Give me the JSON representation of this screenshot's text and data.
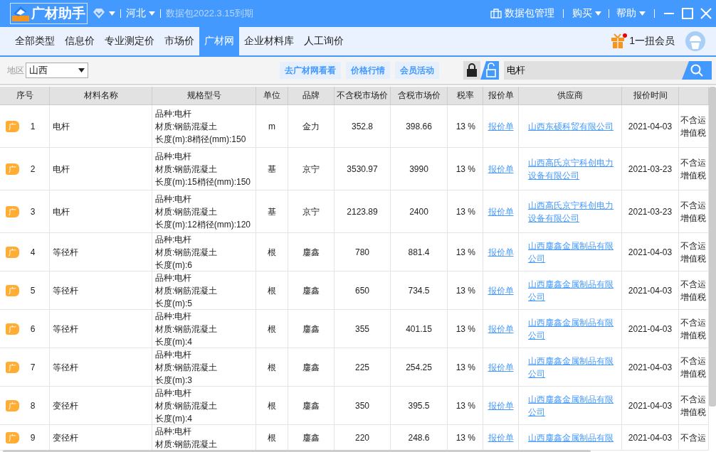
{
  "titlebar": {
    "app_name": "广材助手",
    "region": "河北",
    "expiry": "数据包2022.3.15到期",
    "data_pack": "数据包管理",
    "menus": [
      "购买",
      "帮助"
    ]
  },
  "nav": {
    "tabs": [
      {
        "label": "全部类型",
        "selected": false
      },
      {
        "label": "信息价",
        "selected": false
      },
      {
        "label": "专业测定价",
        "selected": false
      },
      {
        "label": "市场价",
        "selected": false
      },
      {
        "label": "广材网",
        "selected": true
      },
      {
        "label": "企业材料库",
        "selected": false
      },
      {
        "label": "人工询价",
        "selected": false
      }
    ],
    "member": "1一扭会员"
  },
  "toolbar": {
    "region_label": "地区",
    "region_value": "山西",
    "links": [
      "去广材网看看",
      "价格行情",
      "会员活动"
    ],
    "search_value": "电杆"
  },
  "table": {
    "columns": [
      "序号",
      "材料名称",
      "规格型号",
      "单位",
      "品牌",
      "不含税市场价",
      "含税市场价",
      "税率",
      "报价单",
      "供应商",
      "报价时间"
    ],
    "rows": [
      {
        "tag": "广",
        "no": "1",
        "name": "电杆",
        "spec_lines": [
          "品种:电杆",
          "材质:钢筋混凝土",
          "长度(m):8梢径(mm):150"
        ],
        "unit": "m",
        "brand": "金力",
        "price": "352.8",
        "tax_price": "398.66",
        "rate": "13 %",
        "quote": "报价单",
        "supplier": "山西东硕科贸有限公司",
        "date": "2021-04-03",
        "note_lines": [
          "不含运",
          "增值税"
        ]
      },
      {
        "tag": "广",
        "no": "2",
        "name": "电杆",
        "spec_lines": [
          "品种:电杆",
          "材质:钢筋混凝土",
          "长度(m):15梢径(mm):150"
        ],
        "unit": "基",
        "brand": "京宁",
        "price": "3530.97",
        "tax_price": "3990",
        "rate": "13 %",
        "quote": "报价单",
        "supplier": "山西高氏京宁科创电力设备有限公司",
        "date": "2021-03-23",
        "note_lines": [
          "不含运",
          "增值税"
        ]
      },
      {
        "tag": "广",
        "no": "3",
        "name": "电杆",
        "spec_lines": [
          "品种:电杆",
          "材质:钢筋混凝土",
          "长度(m):12梢径(mm):120"
        ],
        "unit": "基",
        "brand": "京宁",
        "price": "2123.89",
        "tax_price": "2400",
        "rate": "13 %",
        "quote": "报价单",
        "supplier": "山西高氏京宁科创电力设备有限公司",
        "date": "2021-03-23",
        "note_lines": [
          "不含运",
          "增值税"
        ]
      },
      {
        "tag": "广",
        "no": "4",
        "name": "等径杆",
        "spec_lines": [
          "品种:电杆",
          "材质:钢筋混凝土",
          "长度(m):6"
        ],
        "unit": "根",
        "brand": "鏖鑫",
        "price": "780",
        "tax_price": "881.4",
        "rate": "13 %",
        "quote": "报价单",
        "supplier": "山西鏖鑫金属制品有限公司",
        "date": "2021-04-03",
        "note_lines": [
          "不含运",
          "增值税"
        ]
      },
      {
        "tag": "广",
        "no": "5",
        "name": "等径杆",
        "spec_lines": [
          "品种:电杆",
          "材质:钢筋混凝土",
          "长度(m):5"
        ],
        "unit": "根",
        "brand": "鏖鑫",
        "price": "650",
        "tax_price": "734.5",
        "rate": "13 %",
        "quote": "报价单",
        "supplier": "山西鏖鑫金属制品有限公司",
        "date": "2021-04-03",
        "note_lines": [
          "不含运",
          "增值税"
        ]
      },
      {
        "tag": "广",
        "no": "6",
        "name": "等径杆",
        "spec_lines": [
          "品种:电杆",
          "材质:钢筋混凝土",
          "长度(m):4"
        ],
        "unit": "根",
        "brand": "鏖鑫",
        "price": "355",
        "tax_price": "401.15",
        "rate": "13 %",
        "quote": "报价单",
        "supplier": "山西鏖鑫金属制品有限公司",
        "date": "2021-04-03",
        "note_lines": [
          "不含运",
          "增值税"
        ]
      },
      {
        "tag": "广",
        "no": "7",
        "name": "等径杆",
        "spec_lines": [
          "品种:电杆",
          "材质:钢筋混凝土",
          "长度(m):3"
        ],
        "unit": "根",
        "brand": "鏖鑫",
        "price": "225",
        "tax_price": "254.25",
        "rate": "13 %",
        "quote": "报价单",
        "supplier": "山西鏖鑫金属制品有限公司",
        "date": "2021-04-03",
        "note_lines": [
          "不含运",
          "增值税"
        ]
      },
      {
        "tag": "广",
        "no": "8",
        "name": "变径杆",
        "spec_lines": [
          "品种:电杆",
          "材质:钢筋混凝土",
          "长度(m):4"
        ],
        "unit": "根",
        "brand": "鏖鑫",
        "price": "350",
        "tax_price": "395.5",
        "rate": "13 %",
        "quote": "报价单",
        "supplier": "山西鏖鑫金属制品有限公司",
        "date": "2021-04-03",
        "note_lines": [
          "不含运",
          "增值税"
        ]
      },
      {
        "tag": "广",
        "no": "9",
        "name": "变径杆",
        "spec_lines": [
          "品种:电杆",
          "材质:钢筋混凝土"
        ],
        "unit": "根",
        "brand": "鏖鑫",
        "price": "220",
        "tax_price": "248.6",
        "rate": "13 %",
        "quote": "报价单",
        "supplier": "山西鏖鑫金属制品有限",
        "date": "2021-04-03",
        "note_lines": [
          "不含运"
        ]
      }
    ]
  }
}
